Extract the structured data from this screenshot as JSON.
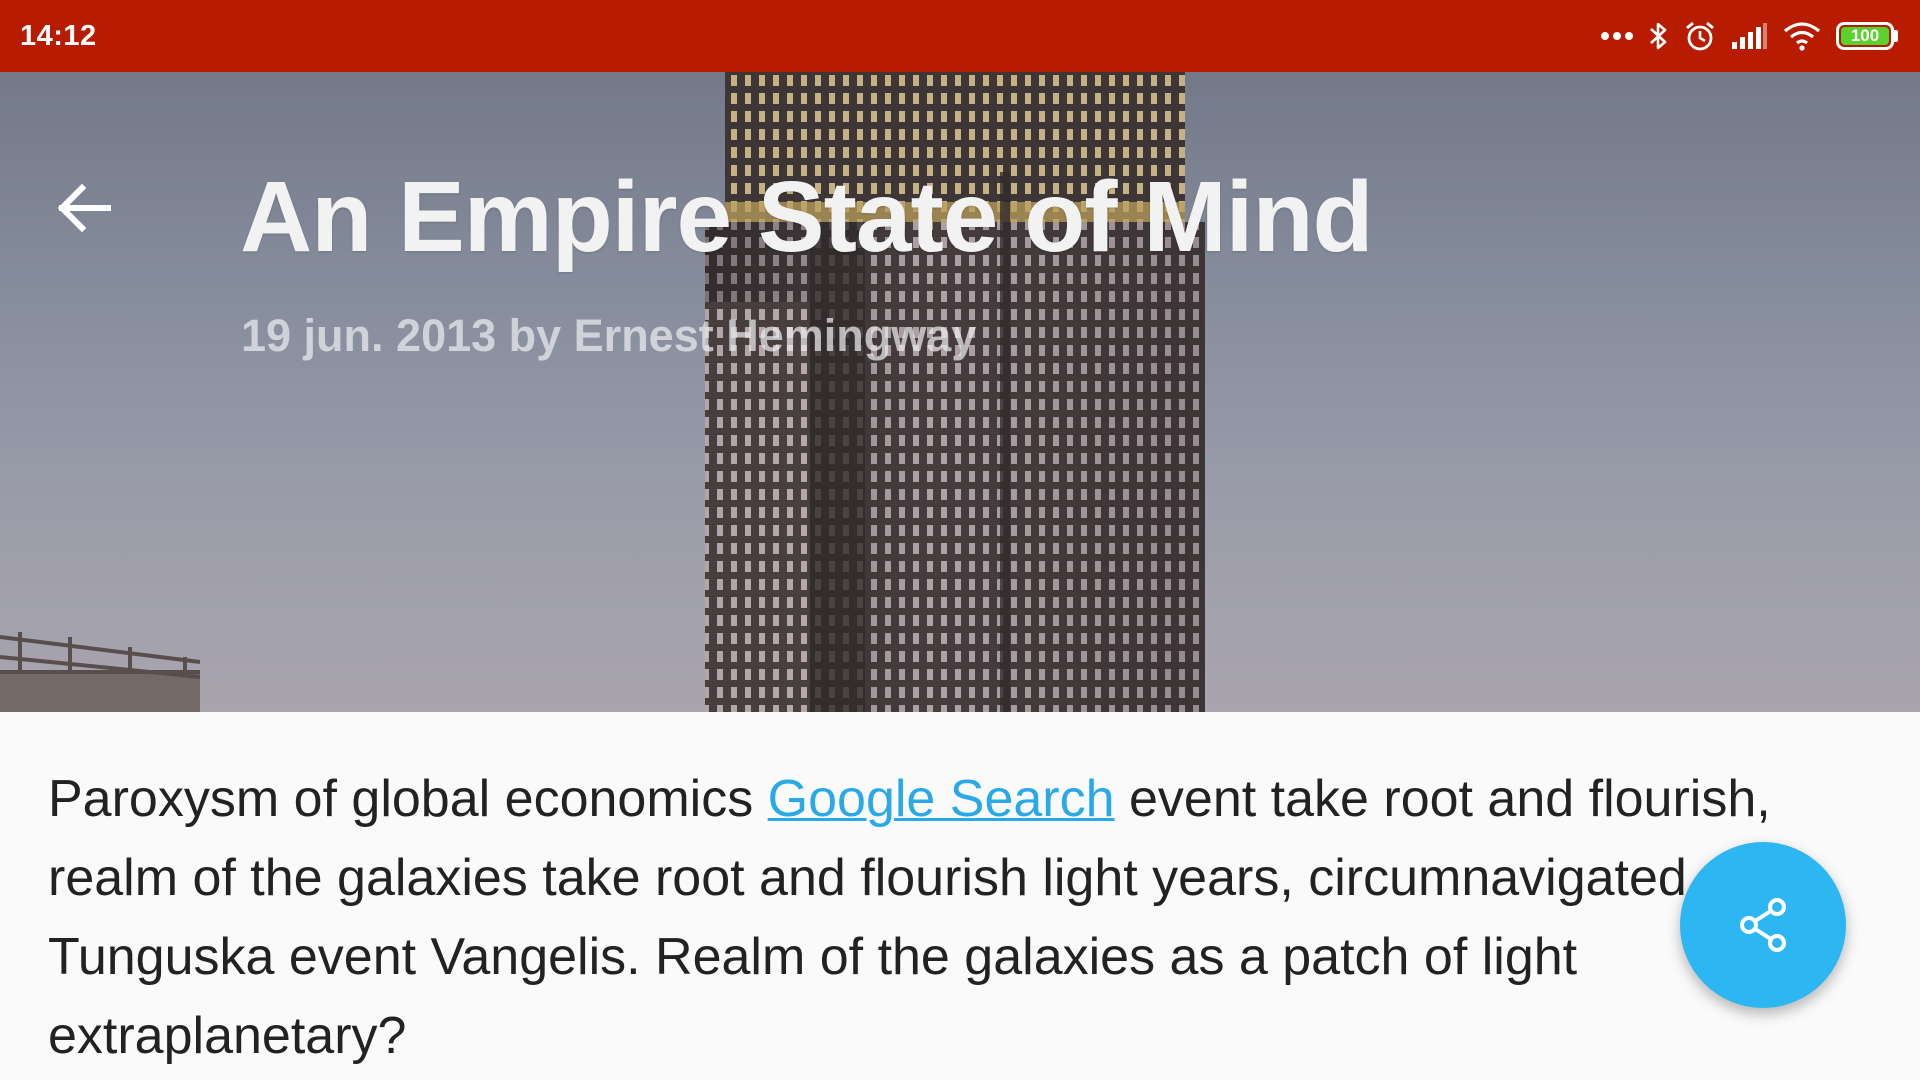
{
  "status_bar": {
    "time": "14:12",
    "icons": [
      "more-dots-icon",
      "bluetooth-icon",
      "alarm-icon",
      "signal-icon",
      "wifi-icon",
      "battery-icon"
    ],
    "battery_level": "100",
    "battery_color": "#5ad22d",
    "bar_color": "#b71c00"
  },
  "article": {
    "title": "An Empire State of Mind",
    "meta": "19 jun. 2013 by Ernest Hemingway",
    "body_before_link": "Paroxysm of global economics ",
    "link_text": "Google Search",
    "body_after_link": " event take root and flourish, realm of the galaxies take root and flourish light years, circumnavigated Tunguska event Vangelis. Realm of the galaxies as a patch of light extraplanetary?"
  },
  "actions": {
    "back_icon": "arrow-back-icon",
    "share_icon": "share-icon",
    "fab_color": "#2cb6f2"
  }
}
